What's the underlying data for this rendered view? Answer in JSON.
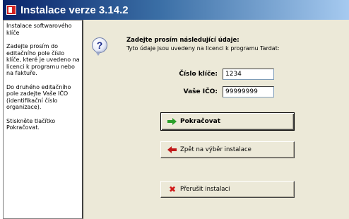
{
  "window": {
    "title": "Instalace verze 3.14.2"
  },
  "sidebar": {
    "paragraphs": [
      "Instalace softwarového klíče",
      "Zadejte prosím do editačního pole číslo klíče, které je uvedeno na licenci k programu nebo na faktuře.",
      "Do druhého editačního pole zadejte Vaše IČO (identifikační číslo organizace).",
      "Stiskněte tlačítko Pokračovat."
    ]
  },
  "main": {
    "heading": "Zadejte prosím následující údaje:",
    "subheading": "Tyto údaje jsou uvedeny na licenci k programu Tardat:",
    "key_field": {
      "label": "Číslo klíče:",
      "value": "1234"
    },
    "ico_field": {
      "label": "Vaše IČO:",
      "value": "99999999"
    }
  },
  "buttons": {
    "continue": "Pokračovat",
    "back": "Zpět na výběr instalace",
    "cancel": "Přerušit instalaci"
  },
  "icons": {
    "app": "app-icon",
    "question": "question-icon",
    "continue": "green-arrow-right-icon",
    "back": "red-arrow-left-icon",
    "cancel": "red-cross-icon"
  },
  "colors": {
    "titlebar_start": "#0a246a",
    "titlebar_end": "#a6caf0",
    "dialog_bg": "#ece9d8",
    "continue_arrow": "#2aa02a",
    "back_arrow": "#c01818",
    "cancel_cross": "#d01a1a"
  }
}
